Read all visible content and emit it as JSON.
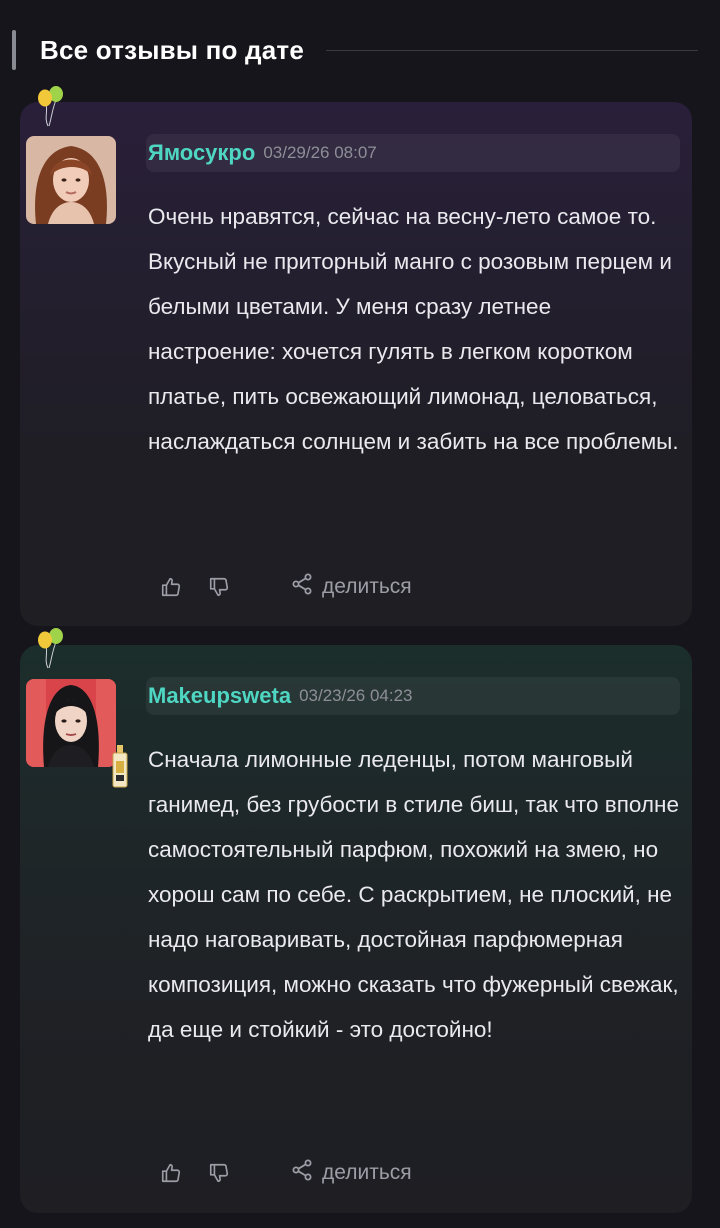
{
  "section": {
    "title": "Все отзывы по дате"
  },
  "reviews": [
    {
      "username": "Ямосукро",
      "date": "03/29/26 08:07",
      "text": "Очень нравятся, сейчас на весну-лето самое то. Вкусный не приторный манго с розовым перцем и белыми цветами. У меня сразу летнее настроение: хочется гулять в легком коротком платье, пить освежающий лимонад, целоваться, наслаждаться солнцем и забить на все проблемы.",
      "share_label": "делиться",
      "icons": {
        "like": "thumbs-up-icon",
        "dislike": "thumbs-down-icon",
        "share": "share-icon",
        "decoration": "balloons-icon"
      }
    },
    {
      "username": "Makeupsweta",
      "date": "03/23/26 04:23",
      "text": "Сначала лимонные леденцы, потом манговый ганимед, без грубости в стиле биш, так что вполне самостоятельный парфюм, похожий на змею, но хорош сам по себе. С раскрытием, не плоский, не надо наговаривать, достойная парфюмерная композиция, можно сказать что фужерный свежак, да еще и стойкий - это достойно!",
      "share_label": "делиться",
      "icons": {
        "like": "thumbs-up-icon",
        "dislike": "thumbs-down-icon",
        "share": "share-icon",
        "decoration": "balloons-icon",
        "badge": "perfume-bottle-icon"
      }
    }
  ],
  "colors": {
    "username": "#4fd6c3",
    "timestamp": "#8e8e98",
    "text": "#e9e9ee",
    "background": "#16151b"
  }
}
